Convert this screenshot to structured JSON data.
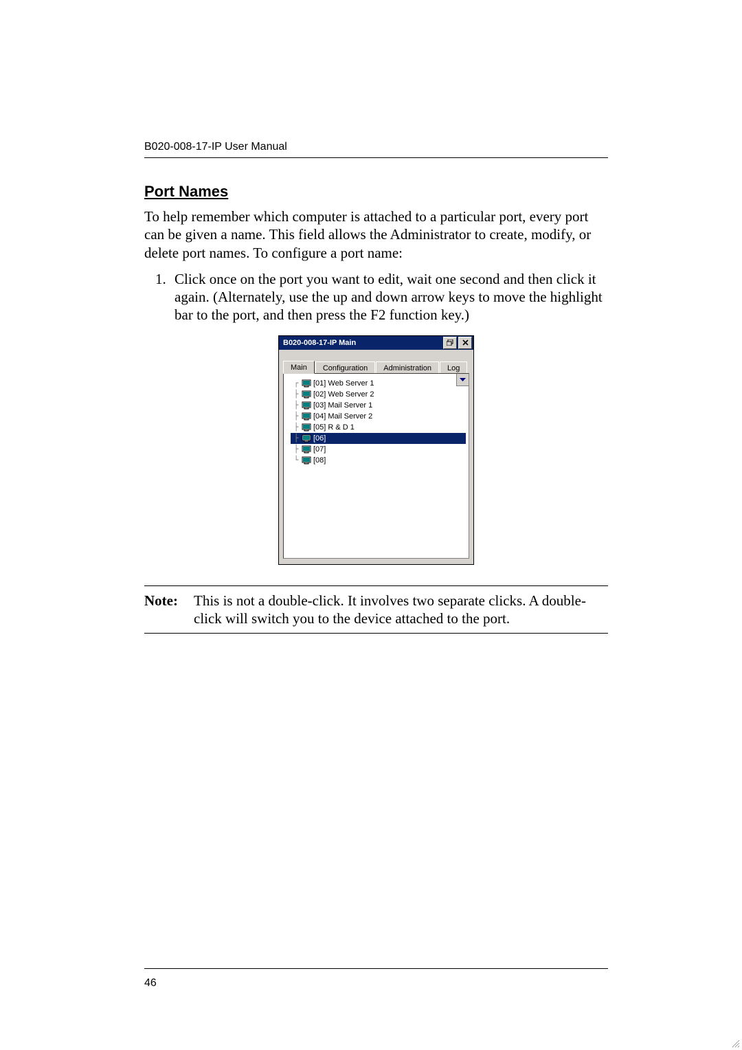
{
  "header": {
    "running": "B020-008-17-IP User Manual"
  },
  "section": {
    "title": "Port Names",
    "intro": "To help remember which computer is attached to a particular port, every port can be given a name. This field allows the Administrator to create, modify, or delete port names. To configure a port name:",
    "step1_marker": "1.",
    "step1": "Click once on the port you want to edit, wait one second and then click it again. (Alternately, use the up and down arrow keys to move the highlight bar to the port, and then press the F2 function key.)"
  },
  "shot": {
    "title": "B020-008-17-IP Main",
    "tabs": {
      "main": "Main",
      "config": "Configuration",
      "admin": "Administration",
      "log": "Log"
    },
    "ports": [
      {
        "slot": "[01]",
        "name": "Web Server 1",
        "sel": false
      },
      {
        "slot": "[02]",
        "name": "Web Server 2",
        "sel": false
      },
      {
        "slot": "[03]",
        "name": "Mail Server 1",
        "sel": false
      },
      {
        "slot": "[04]",
        "name": "Mail Server 2",
        "sel": false
      },
      {
        "slot": "[05]",
        "name": "R & D 1",
        "sel": false
      },
      {
        "slot": "[06]",
        "name": "",
        "sel": true
      },
      {
        "slot": "[07]",
        "name": "",
        "sel": false
      },
      {
        "slot": "[08]",
        "name": "",
        "sel": false
      }
    ],
    "icons": {
      "restore": "restore-icon",
      "close": "close-icon",
      "scroll": "scroll-down-icon",
      "resize": "resize-grip-icon",
      "port": "computer-icon"
    }
  },
  "note": {
    "head": "Note:",
    "body": "This is not a double-click. It involves two separate clicks. A double-click will switch you to the device attached to the port."
  },
  "page_number": "46"
}
